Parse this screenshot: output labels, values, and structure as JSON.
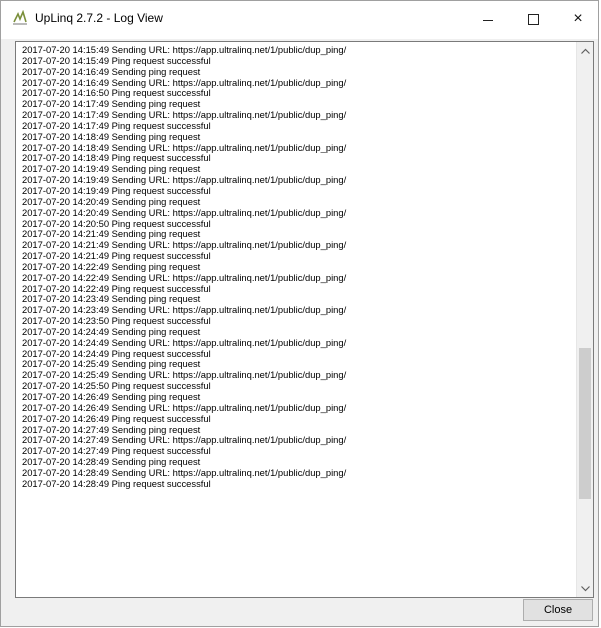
{
  "window": {
    "title": "UpLinq 2.7.2 - Log View",
    "controls": {
      "minimize": "",
      "maximize": "",
      "close": "×"
    }
  },
  "log": {
    "lines": [
      "2017-07-20 14:15:49 Sending URL: https://app.ultralinq.net/1/public/dup_ping/",
      "2017-07-20 14:15:49 Ping request successful",
      "2017-07-20 14:16:49 Sending ping request",
      "2017-07-20 14:16:49 Sending URL: https://app.ultralinq.net/1/public/dup_ping/",
      "2017-07-20 14:16:50 Ping request successful",
      "2017-07-20 14:17:49 Sending ping request",
      "2017-07-20 14:17:49 Sending URL: https://app.ultralinq.net/1/public/dup_ping/",
      "2017-07-20 14:17:49 Ping request successful",
      "2017-07-20 14:18:49 Sending ping request",
      "2017-07-20 14:18:49 Sending URL: https://app.ultralinq.net/1/public/dup_ping/",
      "2017-07-20 14:18:49 Ping request successful",
      "2017-07-20 14:19:49 Sending ping request",
      "2017-07-20 14:19:49 Sending URL: https://app.ultralinq.net/1/public/dup_ping/",
      "2017-07-20 14:19:49 Ping request successful",
      "2017-07-20 14:20:49 Sending ping request",
      "2017-07-20 14:20:49 Sending URL: https://app.ultralinq.net/1/public/dup_ping/",
      "2017-07-20 14:20:50 Ping request successful",
      "2017-07-20 14:21:49 Sending ping request",
      "2017-07-20 14:21:49 Sending URL: https://app.ultralinq.net/1/public/dup_ping/",
      "2017-07-20 14:21:49 Ping request successful",
      "2017-07-20 14:22:49 Sending ping request",
      "2017-07-20 14:22:49 Sending URL: https://app.ultralinq.net/1/public/dup_ping/",
      "2017-07-20 14:22:49 Ping request successful",
      "2017-07-20 14:23:49 Sending ping request",
      "2017-07-20 14:23:49 Sending URL: https://app.ultralinq.net/1/public/dup_ping/",
      "2017-07-20 14:23:50 Ping request successful",
      "2017-07-20 14:24:49 Sending ping request",
      "2017-07-20 14:24:49 Sending URL: https://app.ultralinq.net/1/public/dup_ping/",
      "2017-07-20 14:24:49 Ping request successful",
      "2017-07-20 14:25:49 Sending ping request",
      "2017-07-20 14:25:49 Sending URL: https://app.ultralinq.net/1/public/dup_ping/",
      "2017-07-20 14:25:50 Ping request successful",
      "2017-07-20 14:26:49 Sending ping request",
      "2017-07-20 14:26:49 Sending URL: https://app.ultralinq.net/1/public/dup_ping/",
      "2017-07-20 14:26:49 Ping request successful",
      "2017-07-20 14:27:49 Sending ping request",
      "2017-07-20 14:27:49 Sending URL: https://app.ultralinq.net/1/public/dup_ping/",
      "2017-07-20 14:27:49 Ping request successful",
      "2017-07-20 14:28:49 Sending ping request",
      "2017-07-20 14:28:49 Sending URL: https://app.ultralinq.net/1/public/dup_ping/",
      "2017-07-20 14:28:49 Ping request successful"
    ],
    "scroll_position": 0.78,
    "scroll_visible_fraction": 0.29
  },
  "footer": {
    "close_label": "Close"
  },
  "icons": {
    "app": "uplinq-app-icon",
    "scroll_up": "chevron-up-icon",
    "scroll_down": "chevron-down-icon"
  },
  "colors": {
    "window_bg": "#f0f0f0",
    "log_bg": "#ffffff",
    "scroll_thumb": "#cdcdcd"
  }
}
